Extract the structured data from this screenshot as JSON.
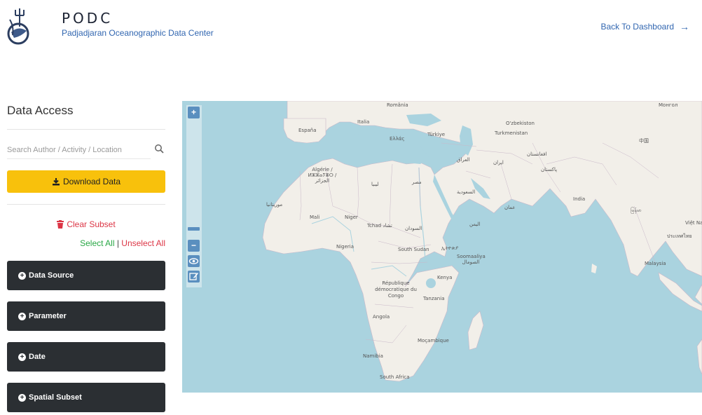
{
  "header": {
    "brand_title": "PODC",
    "brand_subtitle": "Padjadjaran Oceanographic Data Center",
    "back_link": "Back To Dashboard",
    "back_arrow": "→"
  },
  "sidebar": {
    "title": "Data Access",
    "search_placeholder": "Search Author / Activity / Location",
    "download_label": "Download Data",
    "clear_subset_label": "Clear Subset",
    "select_all_label": "Select All",
    "separator": "|",
    "unselect_all_label": "Unselect All",
    "accordions": [
      {
        "label": "Data Source"
      },
      {
        "label": "Parameter"
      },
      {
        "label": "Date"
      },
      {
        "label": "Spatial Subset"
      }
    ]
  },
  "map": {
    "controls": {
      "zoom_in": "+",
      "zoom_out": "−"
    },
    "labels": {
      "romania": "România",
      "espana": "España",
      "italia": "Italia",
      "turkiye": "Türkiye",
      "ellas": "Ελλάς",
      "uzbekistan": "O'zbekiston",
      "turkmenistan": "Turkmenistan",
      "china": "中国",
      "iraq": "العراق",
      "iran": "ایران",
      "afghanistan": "افغانستان",
      "pakistan": "پاکستان",
      "algeria": "Algérie / ⵍⵣⵣⴰⵢⴻⵔ / الجزائر",
      "libya": "ليبيا",
      "egypt": "مصر",
      "saudi": "السعودية",
      "oman": "عمان",
      "mauritania": "موريتانيا",
      "mali": "Mali",
      "niger": "Niger",
      "tchad": "Tchad تشاد",
      "sudan": "السودان",
      "yemen": "اليمن",
      "india": "India",
      "myanmar": "မြန်မာ",
      "vietnam": "Việt Nam",
      "thailand": "ประเทศไทย",
      "nigeria": "Nigeria",
      "south_sudan": "South Sudan",
      "ethiopia": "ኢትዮጵያ",
      "somalia": "Soomaaliya الصومال",
      "malaysia": "Malaysia",
      "kenya": "Kenya",
      "drc": "République démocratique du Congo",
      "tanzania": "Tanzania",
      "angola": "Angola",
      "mozambique": "Moçambique",
      "namibia": "Namibia",
      "south_africa": "South Africa",
      "mongolia": "Монгол"
    }
  },
  "colors": {
    "accent": "#f8c10c",
    "link": "#3166b0",
    "danger": "#dc3545",
    "success": "#28a745",
    "accordion_bg": "#2b2f33",
    "sea": "#aad3df",
    "land": "#f2efe9"
  }
}
